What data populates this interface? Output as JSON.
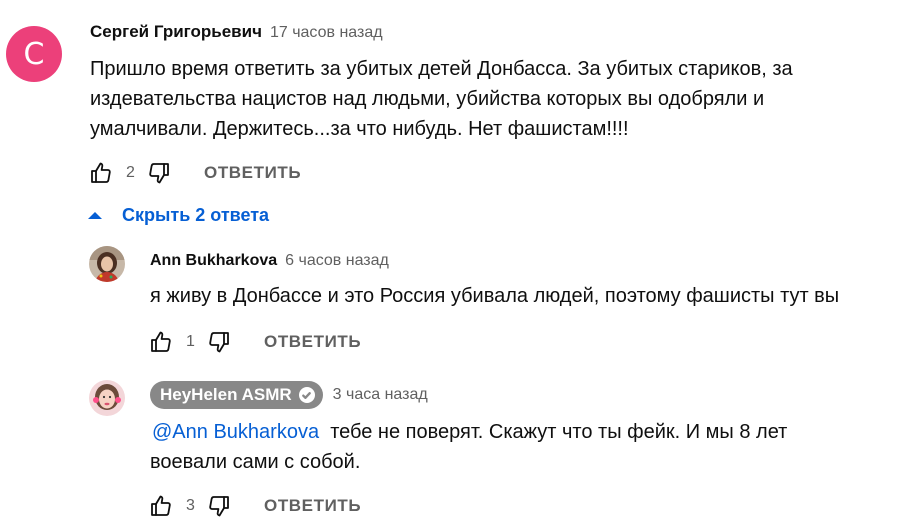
{
  "comment": {
    "avatar_letter": "С",
    "author": "Сергей Григорьевич",
    "time": "17 часов назад",
    "text_lines": [
      "Пришло время ответить за убитых детей Донбасса. За убитых стариков, за",
      "издевательства нацистов над людьми, убийства которых вы одобряли и",
      "умалчивали. Держитесь...за что нибудь. Нет фашистам!!!!"
    ],
    "likes": "2",
    "reply_label": "ОТВЕТИТЬ"
  },
  "replies_toggle": {
    "label": "Скрыть 2 ответа"
  },
  "replies": [
    {
      "author": "Ann Bukharkova",
      "time": "6 часов назад",
      "text": "я живу в Донбассе и это Россия убивала людей, поэтому фашисты тут вы",
      "likes": "1",
      "reply_label": "ОТВЕТИТЬ"
    },
    {
      "author": "HeyHelen ASMR",
      "verified_icon": "checkmark-icon",
      "time": "3 часа назад",
      "mention": "@Ann Bukharkova",
      "text_line1": "тебе не поверят. Скажут что ты фейк. И мы 8 лет",
      "text_line2": "воевали сами с собой.",
      "likes": "3",
      "reply_label": "ОТВЕТИТЬ"
    }
  ],
  "colors": {
    "avatar_main": "#ec407a",
    "link_blue": "#065fd4",
    "secondary_text": "#606060",
    "badge_gray": "#888888"
  }
}
